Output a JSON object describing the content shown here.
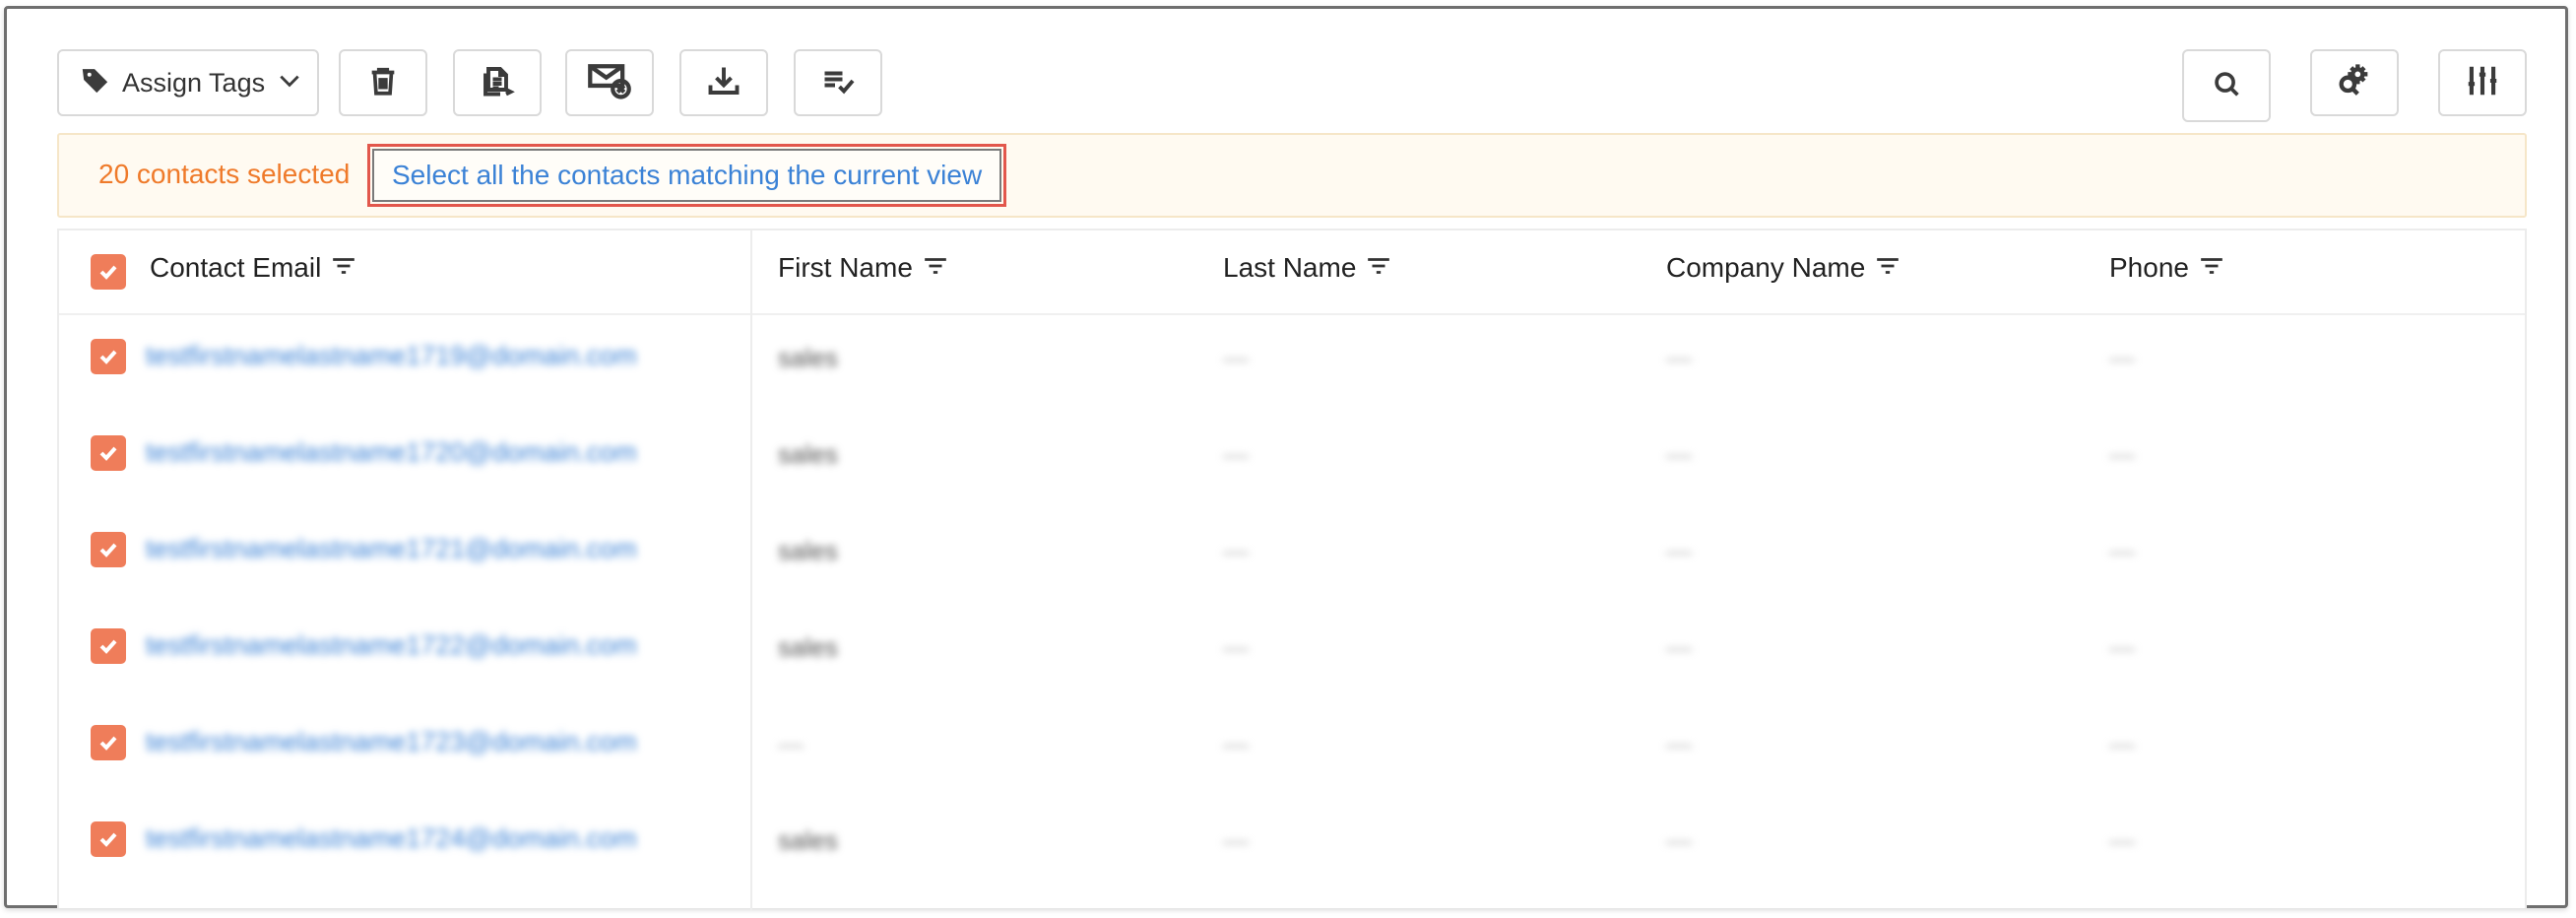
{
  "toolbar": {
    "assign_tags_label": "Assign Tags",
    "icons": [
      "tag-icon",
      "chevron-down-icon",
      "trash-icon",
      "document-export-icon",
      "unsubscribe-mail-icon",
      "download-icon",
      "list-check-icon",
      "search-icon",
      "settings-search-icon",
      "sliders-icon"
    ]
  },
  "banner": {
    "selected_text": "20 contacts selected",
    "select_all_link": "Select all the contacts matching the current view"
  },
  "table": {
    "columns": [
      "Contact Email",
      "First Name",
      "Last Name",
      "Company Name",
      "Phone"
    ],
    "rows": [
      {
        "email": "testfirstnamelastname1719@domain.com",
        "first": "sales",
        "last": "—",
        "company": "—",
        "phone": "—"
      },
      {
        "email": "testfirstnamelastname1720@domain.com",
        "first": "sales",
        "last": "—",
        "company": "—",
        "phone": "—"
      },
      {
        "email": "testfirstnamelastname1721@domain.com",
        "first": "sales",
        "last": "—",
        "company": "—",
        "phone": "—"
      },
      {
        "email": "testfirstnamelastname1722@domain.com",
        "first": "sales",
        "last": "—",
        "company": "—",
        "phone": "—"
      },
      {
        "email": "testfirstnamelastname1723@domain.com",
        "first": "—",
        "last": "—",
        "company": "—",
        "phone": "—"
      },
      {
        "email": "testfirstnamelastname1724@domain.com",
        "first": "sales",
        "last": "—",
        "company": "—",
        "phone": "—"
      }
    ]
  },
  "colors": {
    "accent_orange": "#ef7a2a",
    "checkbox": "#ef7d5a",
    "link_blue": "#3b82d6",
    "highlight": "#e2574c"
  }
}
